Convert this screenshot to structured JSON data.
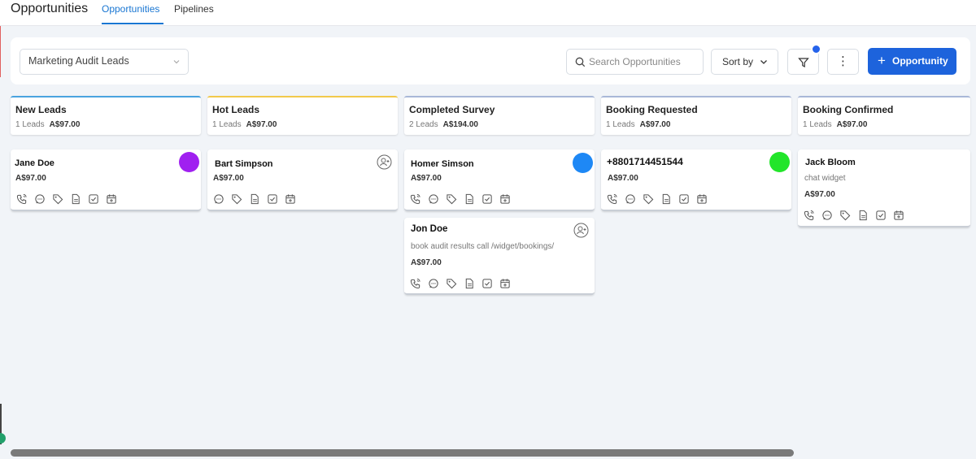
{
  "header": {
    "title": "Opportunities",
    "tabs": [
      {
        "label": "Opportunities",
        "active": true
      },
      {
        "label": "Pipelines",
        "active": false
      }
    ]
  },
  "toolbar": {
    "pipeline": "Marketing Audit Leads",
    "search_placeholder": "Search Opportunities",
    "sort_label": "Sort by",
    "add_label": "Opportunity"
  },
  "columns": [
    {
      "name": "New Leads",
      "count": "1 Leads",
      "total": "A$97.00",
      "color": "#4aa3df"
    },
    {
      "name": "Hot Leads",
      "count": "1 Leads",
      "total": "A$97.00",
      "color": "#f2c94c"
    },
    {
      "name": "Completed Survey",
      "count": "2 Leads",
      "total": "A$194.00",
      "color": "#a9b8d8"
    },
    {
      "name": "Booking Requested",
      "count": "1 Leads",
      "total": "A$97.00",
      "color": "#a9b8d8"
    },
    {
      "name": "Booking Confirmed",
      "count": "1 Leads",
      "total": "A$97.00",
      "color": "#a9b8d8"
    }
  ],
  "cards": {
    "jane": {
      "name": "Jane Doe",
      "value": "A$97.00",
      "avatar_color": "#a020f0"
    },
    "bart": {
      "name": "Bart Simpson",
      "value": "A$97.00"
    },
    "homer": {
      "name": "Homer Simson",
      "value": "A$97.00",
      "avatar_color": "#1e88f5"
    },
    "jon": {
      "name": "Jon Doe",
      "desc": "book audit results call /widget/bookings/",
      "value": "A$97.00"
    },
    "phone": {
      "name": "+8801714451544",
      "value": "A$97.00",
      "avatar_color": "#22e52a"
    },
    "jack": {
      "name": "Jack Bloom",
      "desc": "chat widget",
      "value": "A$97.00"
    }
  },
  "colors": {
    "accent": "#1d63dc",
    "tab_active": "#1976d2"
  }
}
